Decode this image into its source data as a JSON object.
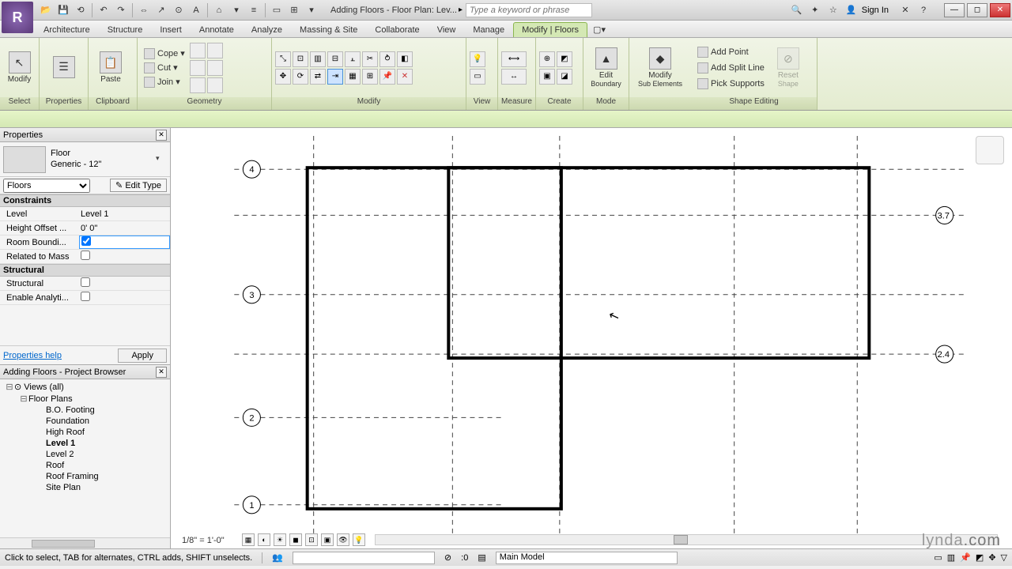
{
  "titlebar": {
    "doc_title": "Adding Floors - Floor Plan: Lev...",
    "search_placeholder": "Type a keyword or phrase",
    "sign_in": "Sign In"
  },
  "tabs": {
    "architecture": "Architecture",
    "structure": "Structure",
    "insert": "Insert",
    "annotate": "Annotate",
    "analyze": "Analyze",
    "massing": "Massing & Site",
    "collaborate": "Collaborate",
    "view": "View",
    "manage": "Manage",
    "modify": "Modify | Floors"
  },
  "ribbon": {
    "select": {
      "modify": "Modify",
      "title": "Select"
    },
    "properties": {
      "properties": "Properties",
      "title": "Properties"
    },
    "clipboard": {
      "paste": "Paste",
      "cope": "Cope",
      "cut": "Cut",
      "join": "Join",
      "title": "Clipboard"
    },
    "geometry": {
      "title": "Geometry"
    },
    "modify_panel": {
      "title": "Modify"
    },
    "view_panel": {
      "title": "View"
    },
    "measure": {
      "title": "Measure"
    },
    "create": {
      "title": "Create"
    },
    "mode": {
      "edit_boundary": "Edit",
      "edit_boundary2": "Boundary",
      "modify_sub": "Modify",
      "modify_sub2": "Sub Elements",
      "title": "Mode"
    },
    "shape": {
      "add_point": "Add Point",
      "add_split": "Add Split Line",
      "pick_supports": "Pick Supports",
      "reset": "Reset",
      "reset2": "Shape",
      "title": "Shape Editing"
    }
  },
  "properties": {
    "header": "Properties",
    "type_line1": "Floor",
    "type_line2": "Generic - 12\"",
    "filter": "Floors",
    "edit_type": "Edit Type",
    "group_constraints": "Constraints",
    "level_key": "Level",
    "level_val": "Level 1",
    "height_key": "Height Offset ...",
    "height_val": "0'   0\"",
    "roombound_key": "Room Boundi...",
    "related_key": "Related to Mass",
    "group_structural": "Structural",
    "structural_key": "Structural",
    "analytical_key": "Enable Analyti...",
    "help": "Properties help",
    "apply": "Apply"
  },
  "browser": {
    "header": "Adding Floors - Project Browser",
    "views": "Views (all)",
    "floor_plans": "Floor Plans",
    "items": {
      "bo": "B.O. Footing",
      "foundation": "Foundation",
      "highroof": "High Roof",
      "level1": "Level 1",
      "level2": "Level 2",
      "roof": "Roof",
      "framing": "Roof Framing",
      "site": "Site Plan"
    }
  },
  "canvas": {
    "scale": "1/8\" = 1'-0\"",
    "grids": {
      "g1": "1",
      "g2": "2",
      "g3": "3",
      "g4": "4",
      "g24": "2.4",
      "g37": "3.7"
    }
  },
  "status": {
    "hint": "Click to select, TAB for alternates, CTRL adds, SHIFT unselects.",
    "count": ":0",
    "workset": "Main Model"
  },
  "logo": {
    "a": "lynda",
    "b": ".com"
  }
}
